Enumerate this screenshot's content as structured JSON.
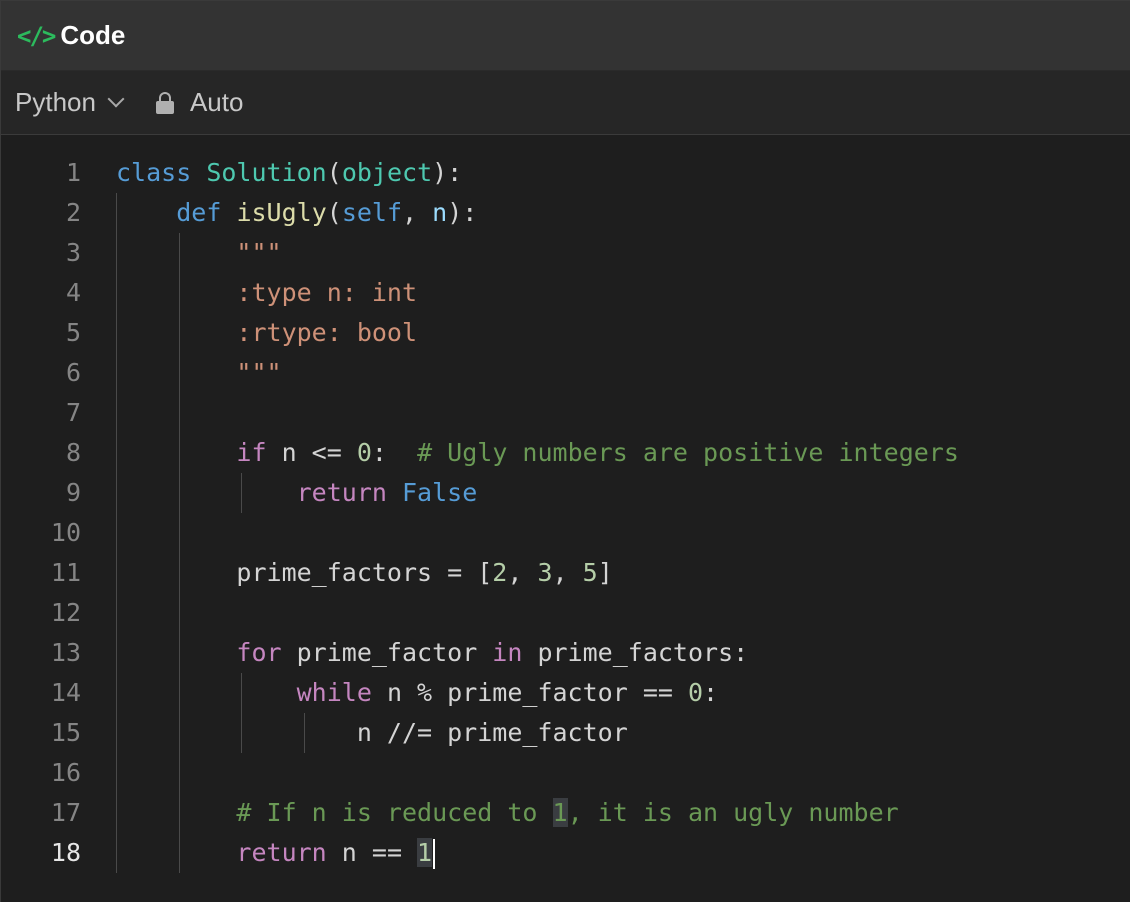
{
  "panel": {
    "icon": "code-icon",
    "title": "Code"
  },
  "toolbar": {
    "language": "Python",
    "mode": "Auto",
    "mode_icon": "lock-icon"
  },
  "editor": {
    "active_line": 18,
    "line_numbers": [
      "1",
      "2",
      "3",
      "4",
      "5",
      "6",
      "7",
      "8",
      "9",
      "10",
      "11",
      "12",
      "13",
      "14",
      "15",
      "16",
      "17",
      "18"
    ],
    "lines": [
      "class Solution(object):",
      "    def isUgly(self, n):",
      "        \"\"\"",
      "        :type n: int",
      "        :rtype: bool",
      "        \"\"\"",
      "",
      "        if n <= 0:  # Ugly numbers are positive integers",
      "            return False",
      "",
      "        prime_factors = [2, 3, 5]",
      "",
      "        for prime_factor in prime_factors:",
      "            while n % prime_factor == 0:",
      "                n //= prime_factor",
      "",
      "        # If n is reduced to 1, it is an ugly number",
      "        return n == 1"
    ]
  },
  "colors": {
    "background": "#1e1e1e",
    "keyword": "#569cd6",
    "control": "#c586c0",
    "class_name": "#4ec9b0",
    "function": "#dcdcaa",
    "number": "#b5cea8",
    "string": "#ce9178",
    "comment": "#6a9955",
    "brand_icon": "#2cbb5d"
  }
}
